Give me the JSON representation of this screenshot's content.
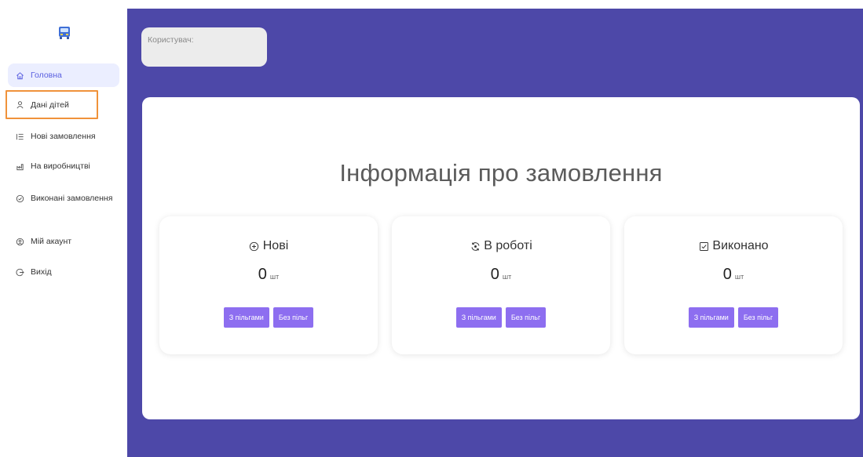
{
  "sidebar": {
    "logo_icon": "bus-icon",
    "items": [
      {
        "label": "Головна",
        "icon": "home-icon",
        "active": true
      },
      {
        "label": "Дані дітей",
        "icon": "user-icon",
        "highlighted": true
      },
      {
        "label": "Нові замовлення",
        "icon": "list-icon"
      },
      {
        "label": "На виробництві",
        "icon": "factory-icon"
      },
      {
        "label": "Виконані замовлення",
        "icon": "check-circle-icon"
      },
      {
        "label": "Мій акаунт",
        "icon": "account-icon"
      },
      {
        "label": "Вихід",
        "icon": "logout-icon"
      }
    ]
  },
  "header": {
    "user_label": "Користувач:"
  },
  "main": {
    "title": "Інформація про замовлення",
    "cards": [
      {
        "title": "Нові",
        "icon": "plus-circle-icon",
        "count": "0",
        "unit": "шт",
        "btn_with": "З пільгами",
        "btn_without": "Без пільг"
      },
      {
        "title": "В роботі",
        "icon": "in-progress-icon",
        "count": "0",
        "unit": "шт",
        "btn_with": "З пільгами",
        "btn_without": "Без пільг"
      },
      {
        "title": "Виконано",
        "icon": "checkbox-icon",
        "count": "0",
        "unit": "шт",
        "btn_with": "З пільгами",
        "btn_without": "Без пільг"
      }
    ]
  },
  "colors": {
    "main_bg": "#4d48a8",
    "accent": "#8d6ef0",
    "active_nav_bg": "#ebeeff",
    "highlight_border": "#f0923a"
  }
}
